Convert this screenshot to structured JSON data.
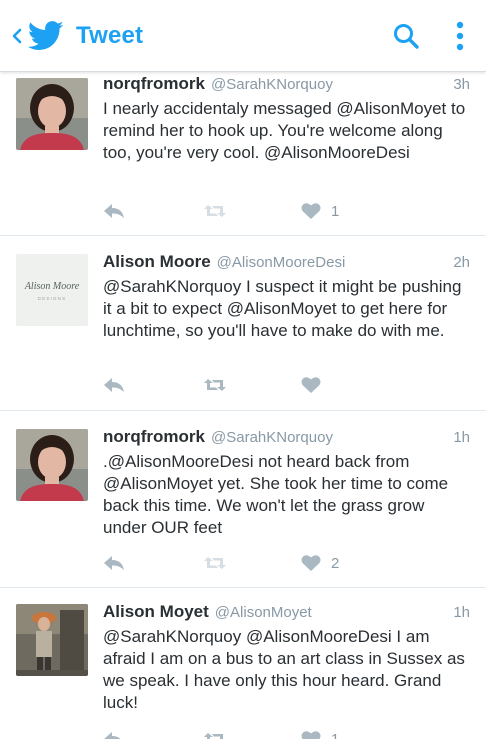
{
  "appbar": {
    "title": "Tweet",
    "back_icon": "chevron-left-icon",
    "logo_icon": "twitter-bird-icon",
    "search_icon": "search-icon",
    "more_icon": "more-vertical-icon",
    "accent_color": "#1da1f2"
  },
  "tweets": [
    {
      "name": "norqfromork",
      "handle": "@SarahKNorquoy",
      "time": "3h",
      "text": "I nearly accidentaly messaged @AlisonMoyet to remind her to hook up. You're welcome along too, you're very cool. @AlisonMooreDesi",
      "like_count": "1"
    },
    {
      "name": "Alison Moore",
      "handle": "@AlisonMooreDesi",
      "time": "2h",
      "text": "@SarahKNorquoy I suspect it might be pushing it a bit to expect @AlisonMoyet to get here for lunchtime, so you'll have to make do with me.",
      "like_count": "",
      "avatar_logo": {
        "line1": "Alison Moore",
        "line2": "DESIGNS"
      }
    },
    {
      "name": "norqfromork",
      "handle": "@SarahKNorquoy",
      "time": "1h",
      "text": ".@AlisonMooreDesi not heard back from @AlisonMoyet yet. She took her time to come back this time. We won't let the grass grow under OUR feet",
      "like_count": "2"
    },
    {
      "name": "Alison Moyet",
      "handle": "@AlisonMoyet",
      "time": "1h",
      "text": "@SarahKNorquoy @AlisonMooreDesi I am afraid I am on a bus to an art class in Sussex as we speak. I have only this hour heard. Grand luck!",
      "like_count": "1"
    }
  ]
}
